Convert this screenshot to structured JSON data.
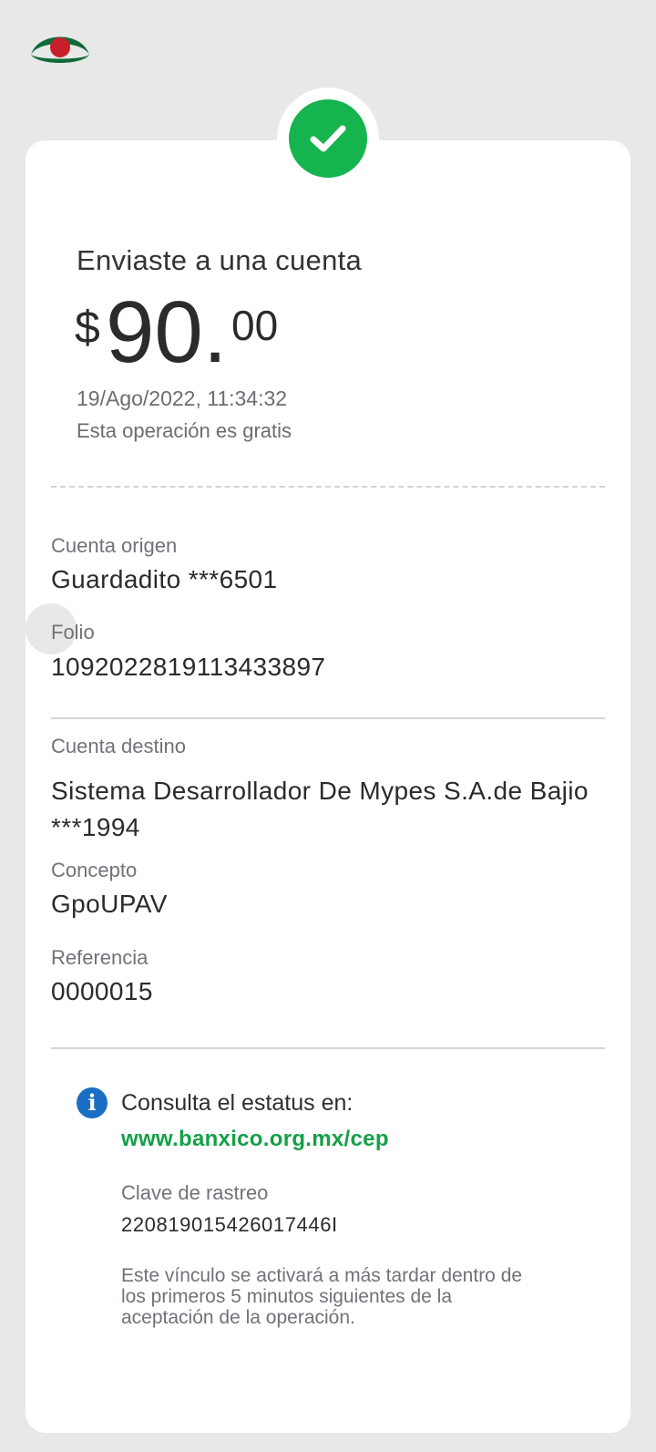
{
  "header": {
    "logo_icon": "bank-logo-icon"
  },
  "status": {
    "icon": "check-icon",
    "color": "#16b44f"
  },
  "summary": {
    "title": "Enviaste a una cuenta",
    "amount_currency": "$",
    "amount_integer": "90.",
    "amount_decimal": "00",
    "datetime": "19/Ago/2022, 11:34:32",
    "fee_note": "Esta operación es gratis"
  },
  "details": {
    "origin_label": "Cuenta origen",
    "origin_value": "Guardadito ***6501",
    "folio_label": "Folio",
    "folio_value": "1092022819113433897",
    "destination_label": "Cuenta destino",
    "destination_value": "Sistema Desarrollador De Mypes  S.A.de Bajio ***1994",
    "concept_label": "Concepto",
    "concept_value": "GpoUPAV",
    "reference_label": "Referencia",
    "reference_value": "0000015"
  },
  "status_info": {
    "icon": "info-icon",
    "consult_text": "Consulta el estatus en:",
    "link_text": "www.banxico.org.mx/cep",
    "tracking_label": "Clave de rastreo",
    "tracking_value": "2208190154260174​46I",
    "note": "Este vínculo se activará a más tardar dentro de los primeros 5 minutos siguientes de la aceptación de la operación."
  },
  "colors": {
    "accent_green": "#16b44f",
    "link_green": "#14a046",
    "info_blue": "#1a6fc4",
    "logo_green": "#0f6b3a",
    "logo_red": "#c8202a"
  }
}
